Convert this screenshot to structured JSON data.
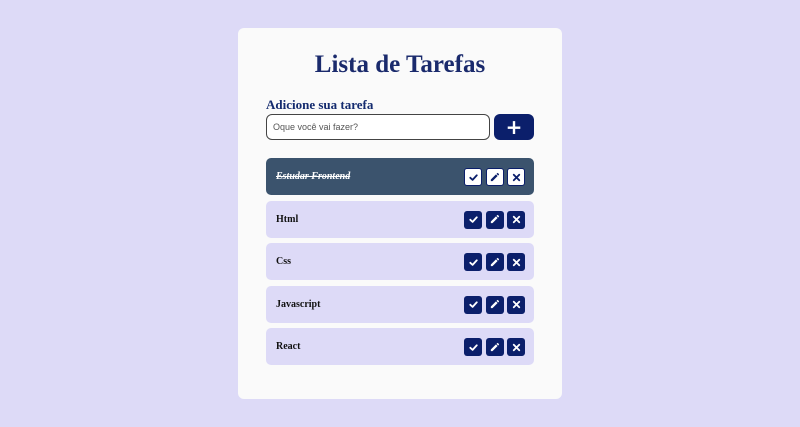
{
  "app": {
    "title": "Lista de Tarefas"
  },
  "form": {
    "label": "Adicione sua tarefa",
    "placeholder": "Oque você vai fazer?",
    "value": "",
    "add_button_label": "+"
  },
  "tasks": [
    {
      "text": "Estudar Frontend",
      "done": true
    },
    {
      "text": "Html",
      "done": false
    },
    {
      "text": "Css",
      "done": false
    },
    {
      "text": "Javascript",
      "done": false
    },
    {
      "text": "React",
      "done": false
    }
  ],
  "icons": {
    "complete": "check-icon",
    "edit": "pencil-icon",
    "remove": "close-icon"
  },
  "colors": {
    "page_background": "#dddaf7",
    "card_background": "#fafafa",
    "primary": "#0b1f6b",
    "task_background": "#dddaf7",
    "task_done_background": "#3b536d"
  }
}
